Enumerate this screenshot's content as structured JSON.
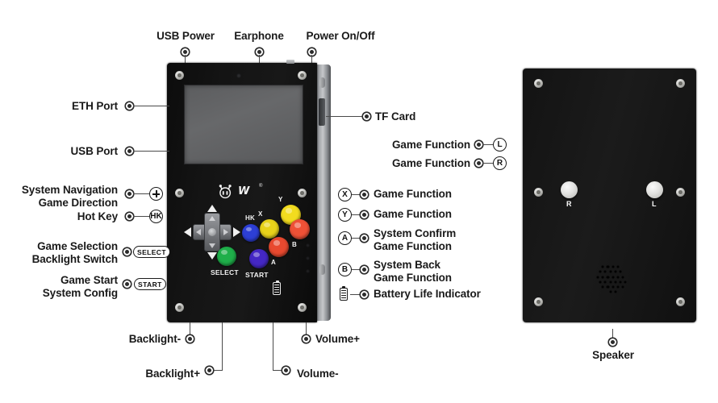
{
  "diagram": {
    "title": "Handheld Game Console Component Callouts",
    "background_color": "#ffffff",
    "label_color": "#1a1a1a",
    "device_body_color": "#141414",
    "device_edge_color": "#9ea1a5",
    "screen_color": "#5f6062"
  },
  "top_labels": [
    {
      "text": "USB Power",
      "badge": ""
    },
    {
      "text": "Earphone",
      "badge": ""
    },
    {
      "text": "Power On/Off",
      "badge": ""
    }
  ],
  "left_labels": [
    {
      "line1": "ETH Port",
      "line2": "",
      "badge": "",
      "badge_type": "none"
    },
    {
      "line1": "USB Port",
      "line2": "",
      "badge": "",
      "badge_type": "none"
    },
    {
      "line1": "System Navigation",
      "line2": "Game Direction",
      "badge": "+",
      "badge_type": "plus"
    },
    {
      "line1": "Hot Key",
      "line2": "",
      "badge": "HK",
      "badge_type": "circle"
    },
    {
      "line1": "Game Selection",
      "line2": "Backlight Switch",
      "badge": "SELECT",
      "badge_type": "pill"
    },
    {
      "line1": "Game Start",
      "line2": "System Config",
      "badge": "START",
      "badge_type": "pill"
    }
  ],
  "right_labels": [
    {
      "line1": "TF Card",
      "line2": "",
      "badge": "",
      "badge_type": "none",
      "badge_side": "none"
    },
    {
      "line1": "Game Function",
      "line2": "",
      "badge": "L",
      "badge_type": "circle",
      "badge_side": "right"
    },
    {
      "line1": "Game Function",
      "line2": "",
      "badge": "R",
      "badge_type": "circle",
      "badge_side": "right"
    },
    {
      "line1": "Game Function",
      "line2": "",
      "badge": "X",
      "badge_type": "circle",
      "badge_side": "left"
    },
    {
      "line1": "Game Function",
      "line2": "",
      "badge": "Y",
      "badge_type": "circle",
      "badge_side": "left"
    },
    {
      "line1": "System Confirm",
      "line2": "Game Function",
      "badge": "A",
      "badge_type": "circle",
      "badge_side": "left"
    },
    {
      "line1": "System Back",
      "line2": "Game Function",
      "badge": "B",
      "badge_type": "circle",
      "badge_side": "left"
    },
    {
      "line1": "Battery Life Indicator",
      "line2": "",
      "badge": "battery",
      "badge_type": "battery",
      "badge_side": "left"
    }
  ],
  "bottom_labels": [
    {
      "text": "Backlight-",
      "align": "right"
    },
    {
      "text": "Backlight+",
      "align": "right"
    },
    {
      "text": "Volume+",
      "align": "left"
    },
    {
      "text": "Volume-",
      "align": "left"
    }
  ],
  "back_device": {
    "caption": "Speaker",
    "buttons": [
      {
        "label": "R"
      },
      {
        "label": "L"
      }
    ]
  },
  "front_device": {
    "logo_text": "W",
    "logo_registered": "®",
    "face_buttons": [
      {
        "name": "hot-key",
        "cap": "HK",
        "color": "#2d3fd6"
      },
      {
        "name": "x-button",
        "cap": "X",
        "color": "#e8d21a"
      },
      {
        "name": "y-button",
        "cap": "Y",
        "color": "#f2dc1f"
      },
      {
        "name": "a-button",
        "cap": "A",
        "color": "#e8492f"
      },
      {
        "name": "b-button",
        "cap": "B",
        "color": "#ef5136"
      },
      {
        "name": "select-button",
        "cap": "SELECT",
        "color": "#1faf4a"
      },
      {
        "name": "start-button",
        "cap": "START",
        "color": "#4427c4"
      }
    ]
  }
}
